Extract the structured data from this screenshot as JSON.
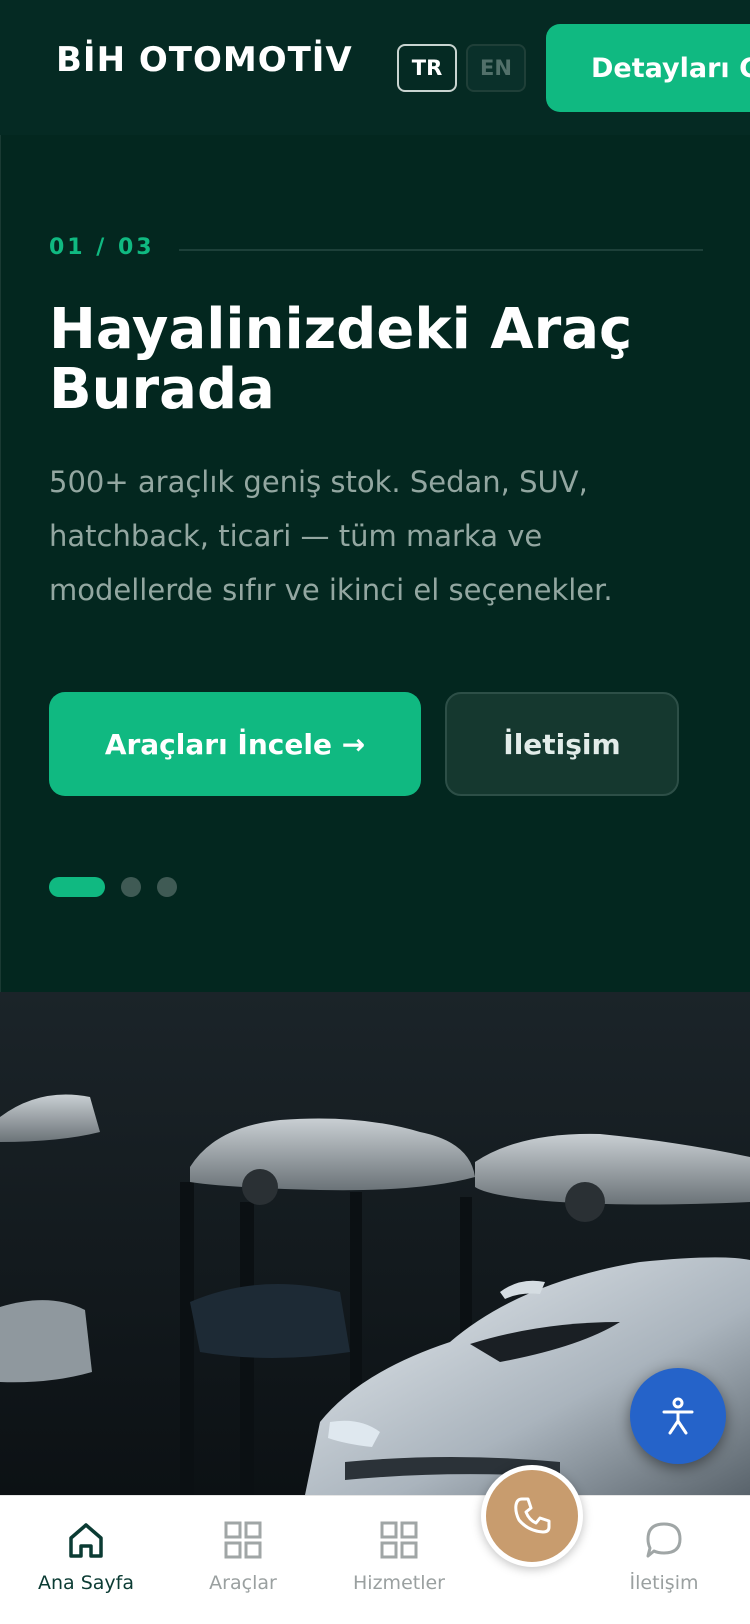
{
  "header": {
    "brand": "BİH OTOMOTİV",
    "lang_tr": "TR",
    "lang_en": "EN",
    "details_button": "Detayları G"
  },
  "hero": {
    "counter": "01 / 03",
    "title": "Hayalinizdeki Araç Burada",
    "description": "500+ araçlık geniş stok. Sedan, SUV, hatchback, ticari — tüm marka ve modellerde sıfır ve ikinci el seçenekler.",
    "primary_button": "Araçları İncele →",
    "secondary_button": "İletişim",
    "slides_total": 3,
    "active_slide": 1
  },
  "bottom_nav": {
    "items": [
      {
        "label": "Ana Sayfa",
        "icon": "home-icon",
        "active": true
      },
      {
        "label": "Araçlar",
        "icon": "grid-icon",
        "active": false
      },
      {
        "label": "Hizmetler",
        "icon": "grid-icon",
        "active": false
      },
      {
        "label": "İletişim",
        "icon": "chat-bubble-icon",
        "active": false
      }
    ],
    "call_icon": "phone-icon"
  },
  "floating": {
    "accessibility_icon": "accessibility-icon"
  },
  "colors": {
    "background": "#03271f",
    "accent": "#10b981",
    "call_button": "#c89c6e",
    "accessibility_button": "#2563c9"
  }
}
